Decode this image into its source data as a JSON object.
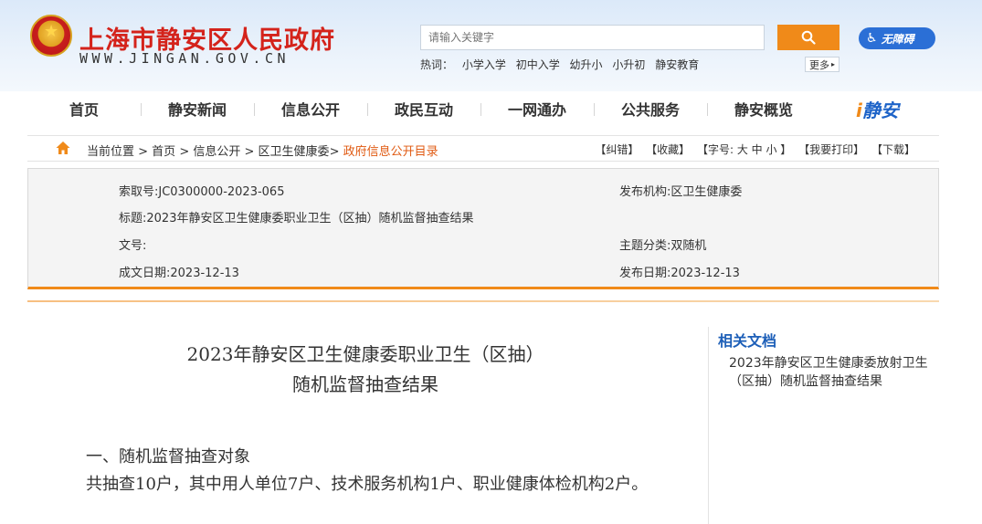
{
  "header": {
    "site_title": "上海市静安区人民政府",
    "site_url": "WWW.JINGAN.GOV.CN",
    "search_placeholder": "请输入关键字",
    "accessibility_label": "无障碍",
    "hot_label": "热词：",
    "hot_words": [
      "小学入学",
      "初中入学",
      "幼升小",
      "小升初",
      "静安教育"
    ],
    "more_label": "更多"
  },
  "nav": {
    "items": [
      "首页",
      "静安新闻",
      "信息公开",
      "政民互动",
      "一网通办",
      "公共服务",
      "静安概览"
    ],
    "logo_text": "静安"
  },
  "breadcrumb": {
    "prefix": "当前位置 > ",
    "path": [
      "首页",
      "信息公开",
      "区卫生健康委"
    ],
    "current": "政府信息公开目录",
    "tools": [
      "【纠错】",
      "【收藏】",
      "【字号: 大 中 小 】",
      "【我要打印】",
      "【下载】"
    ]
  },
  "meta": {
    "index_no": "索取号:JC0300000-2023-065",
    "publisher": "发布机构:区卫生健康委",
    "title": "标题:2023年静安区卫生健康委职业卫生（区抽）随机监督抽查结果",
    "doc_no": "文号:",
    "category": "主题分类:双随机",
    "created": "成文日期:2023-12-13",
    "published": "发布日期:2023-12-13"
  },
  "article": {
    "title_line1": "2023年静安区卫生健康委职业卫生（区抽）",
    "title_line2": "随机监督抽查结果",
    "section1": "一、随机监督抽查对象",
    "para1": "共抽查10户，其中用人单位7户、技术服务机构1户、职业健康体检机构2户。"
  },
  "sidebar": {
    "title": "相关文档",
    "link": "2023年静安区卫生健康委放射卫生（区抽）随机监督抽查结果"
  },
  "colors": {
    "brand_red": "#d4231b",
    "accent_orange": "#f08a19",
    "link_blue": "#1d5fb8"
  }
}
